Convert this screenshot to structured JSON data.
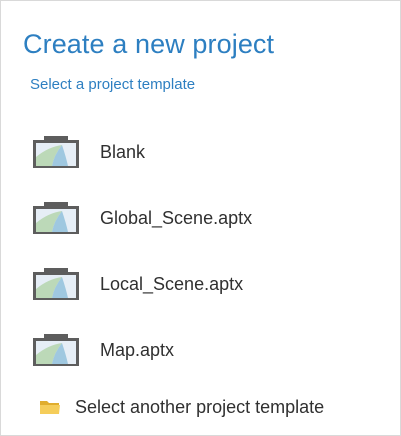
{
  "header": {
    "title": "Create a new project",
    "subtitle": "Select a project template"
  },
  "templates": [
    {
      "label": "Blank",
      "icon": "project-template-icon"
    },
    {
      "label": "Global_Scene.aptx",
      "icon": "project-template-icon"
    },
    {
      "label": "Local_Scene.aptx",
      "icon": "project-template-icon"
    },
    {
      "label": "Map.aptx",
      "icon": "project-template-icon"
    }
  ],
  "footer": {
    "another_label": "Select another project template",
    "icon": "folder-open-icon"
  },
  "colors": {
    "accent": "#2d7fc1",
    "text": "#303030",
    "folder": "#f2c94c"
  }
}
